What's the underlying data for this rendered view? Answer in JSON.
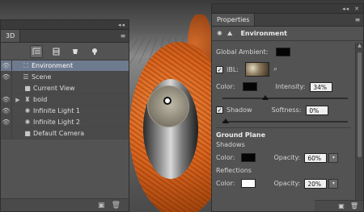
{
  "viewport": {
    "colors": {
      "ring": "#d9641e",
      "ring_dark": "#8a3808",
      "light_marker": "#ffffff"
    }
  },
  "panel3d": {
    "collapse_glyph": "◂◂",
    "close_glyph": "✕",
    "tab_label": "3D",
    "menu_glyph": "≡",
    "toolbar": {
      "icons": [
        "scene-filter-icon",
        "mesh-filter-icon",
        "material-filter-icon",
        "light-filter-icon"
      ]
    },
    "tree": [
      {
        "label": "Environment",
        "icon": "environment-icon",
        "level": 0,
        "selected": true,
        "expandable": false
      },
      {
        "label": "Scene",
        "icon": "scene-icon",
        "level": 0,
        "selected": false,
        "expandable": false
      },
      {
        "label": "Current View",
        "icon": "camera-icon",
        "level": 1,
        "selected": false,
        "expandable": false
      },
      {
        "label": "bold",
        "icon": "mesh-icon",
        "level": 1,
        "selected": false,
        "expandable": true
      },
      {
        "label": "Infinite Light 1",
        "icon": "light-icon",
        "level": 1,
        "selected": false,
        "expandable": false
      },
      {
        "label": "Infinite Light 2",
        "icon": "light-icon",
        "level": 1,
        "selected": false,
        "expandable": false
      },
      {
        "label": "Default Camera",
        "icon": "camera-icon",
        "level": 1,
        "selected": false,
        "expandable": false
      }
    ],
    "footer_icons": [
      "new-item-icon",
      "trash-icon"
    ]
  },
  "properties": {
    "collapse_glyph": "◂◂",
    "close_glyph": "✕",
    "tab_label": "Properties",
    "menu_glyph": "≡",
    "mode_label": "Environment",
    "global_ambient_label": "Global Ambient:",
    "ibl_label": "IBL:",
    "ibl_checked": true,
    "color_label": "Color:",
    "intensity_label": "Intensity:",
    "intensity_value": "34%",
    "intensity_fraction": 0.34,
    "shadow_label": "Shadow",
    "shadow_checked": true,
    "softness_label": "Softness:",
    "softness_value": "0%",
    "softness_fraction": 0.0,
    "ground_plane_label": "Ground Plane",
    "shadows_label": "Shadows",
    "shadows_color_label": "Color:",
    "shadows_color": "#050505",
    "opacity_label": "Opacity:",
    "shadows_opacity": "60%",
    "reflections_label": "Reflections",
    "reflections_color_label": "Color:",
    "reflections_color": "#ffffff",
    "reflections_opacity_label": "Opacity:",
    "reflections_opacity": "20%",
    "global_ambient_color": "#050505",
    "ibl_color": "#050505"
  }
}
